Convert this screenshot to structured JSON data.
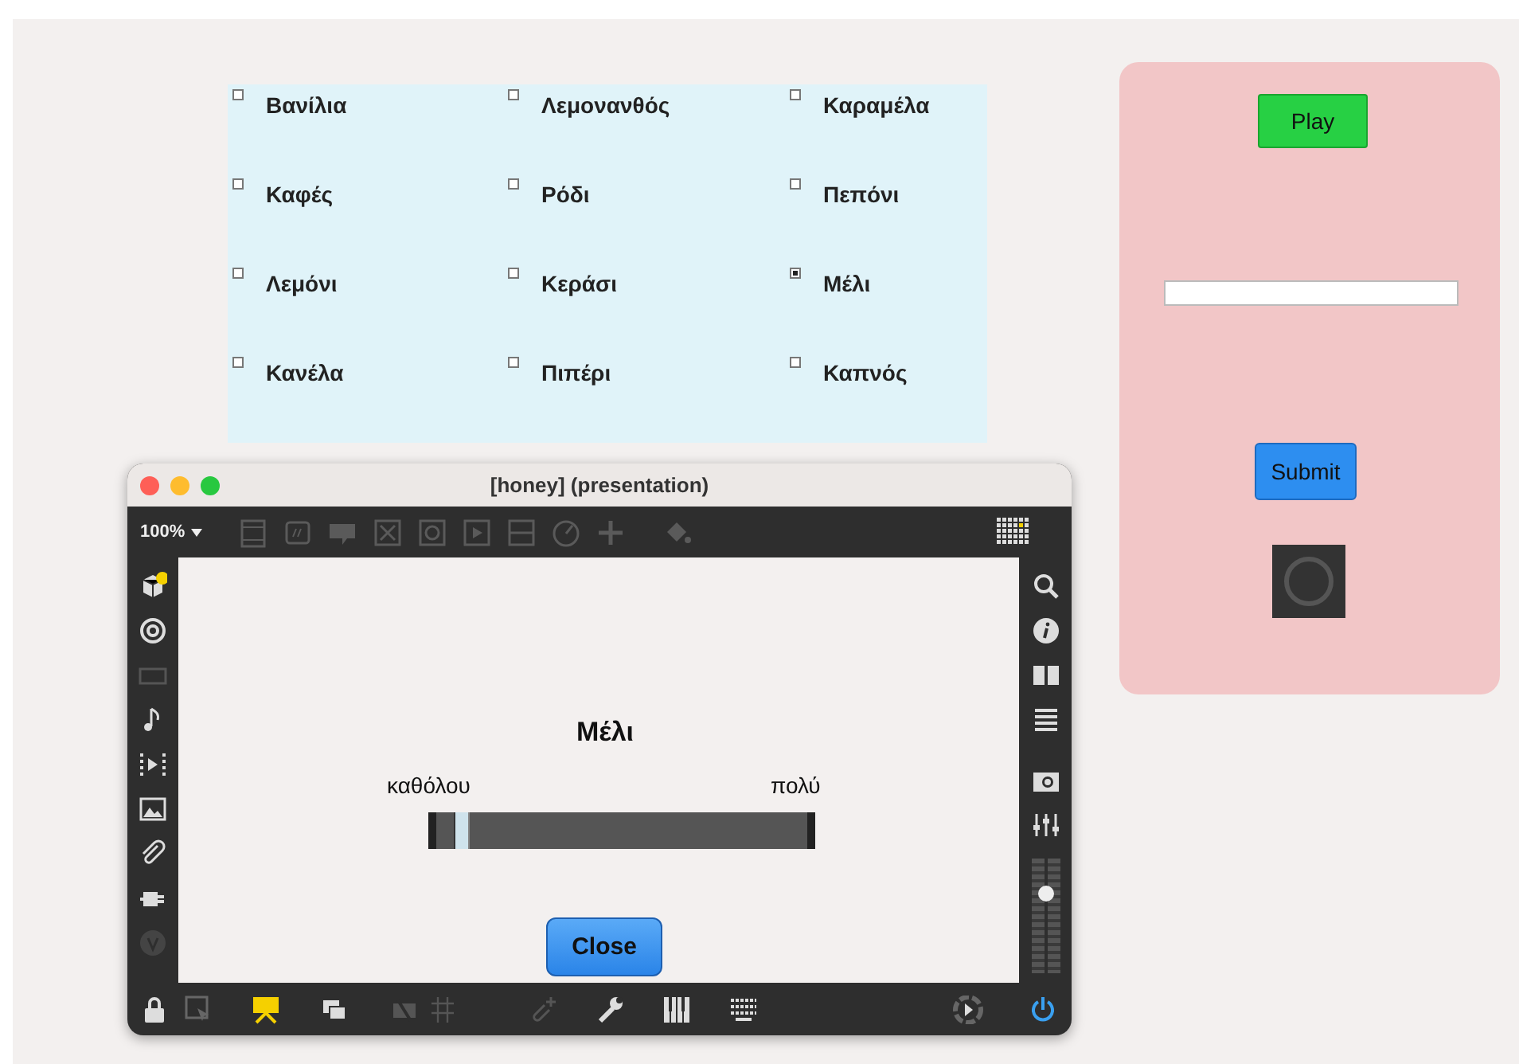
{
  "checkboxes": [
    {
      "label": "Βανίλια",
      "checked": false
    },
    {
      "label": "Λεμονανθός",
      "checked": false
    },
    {
      "label": "Καραμέλα",
      "checked": false
    },
    {
      "label": "Καφές",
      "checked": false
    },
    {
      "label": "Ρόδι",
      "checked": false
    },
    {
      "label": "Πεπόνι",
      "checked": false
    },
    {
      "label": "Λεμόνι",
      "checked": false
    },
    {
      "label": "Κεράσι",
      "checked": false
    },
    {
      "label": "Μέλι",
      "checked": true
    },
    {
      "label": "Κανέλα",
      "checked": false
    },
    {
      "label": "Πιπέρι",
      "checked": false
    },
    {
      "label": "Καπνός",
      "checked": false
    }
  ],
  "panel": {
    "play_button": "Play",
    "submit_button": "Submit"
  },
  "window": {
    "title": "[honey] (presentation)",
    "zoom": "100%",
    "presentation_mode": true,
    "slider": {
      "title": "Μέλι",
      "min_label": "καθόλου",
      "max_label": "πολύ",
      "level": 0.05
    },
    "close_button": "Close",
    "gain_slider": {
      "level": 0.72
    }
  }
}
